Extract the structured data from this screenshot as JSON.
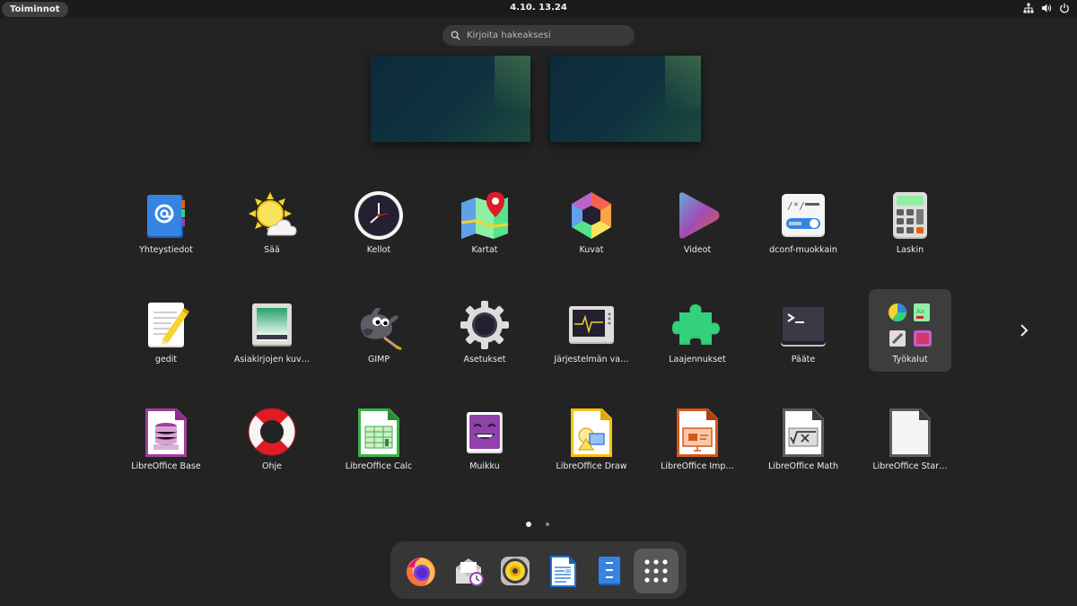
{
  "topbar": {
    "activities": "Toiminnot",
    "clock": "4.10.  13.24",
    "tray": {
      "network_icon": "network-wired-icon",
      "volume_icon": "speaker-icon",
      "power_icon": "power-icon"
    }
  },
  "search": {
    "placeholder": "Kirjoita hakeaksesi"
  },
  "apps": [
    {
      "label": "Yhteystiedot",
      "icon": "contacts-icon"
    },
    {
      "label": "Sää",
      "icon": "weather-icon"
    },
    {
      "label": "Kellot",
      "icon": "clock-icon"
    },
    {
      "label": "Kartat",
      "icon": "maps-icon"
    },
    {
      "label": "Kuvat",
      "icon": "photos-icon"
    },
    {
      "label": "Videot",
      "icon": "videos-icon"
    },
    {
      "label": "dconf-muokkain",
      "icon": "dconf-editor-icon"
    },
    {
      "label": "Laskin",
      "icon": "calculator-icon"
    },
    {
      "label": "gedit",
      "icon": "text-editor-icon"
    },
    {
      "label": "Asiakirjojen kuv…",
      "icon": "document-scanner-icon"
    },
    {
      "label": "GIMP",
      "icon": "gimp-icon"
    },
    {
      "label": "Asetukset",
      "icon": "settings-gear-icon"
    },
    {
      "label": "Järjestelmän va…",
      "icon": "system-monitor-icon"
    },
    {
      "label": "Laajennukset",
      "icon": "extensions-puzzle-icon"
    },
    {
      "label": "Pääte",
      "icon": "terminal-icon"
    },
    {
      "label": "Työkalut",
      "icon": "utilities-folder-icon"
    },
    {
      "label": "LibreOffice Base",
      "icon": "libreoffice-base-icon"
    },
    {
      "label": "Ohje",
      "icon": "help-lifebuoy-icon"
    },
    {
      "label": "LibreOffice Calc",
      "icon": "libreoffice-calc-icon"
    },
    {
      "label": "Muikku",
      "icon": "muikku-icon"
    },
    {
      "label": "LibreOffice Draw",
      "icon": "libreoffice-draw-icon"
    },
    {
      "label": "LibreOffice Imp…",
      "icon": "libreoffice-impress-icon"
    },
    {
      "label": "LibreOffice Math",
      "icon": "libreoffice-math-icon"
    },
    {
      "label": "LibreOffice Star…",
      "icon": "libreoffice-start-icon"
    }
  ],
  "pagination": {
    "current": 1,
    "total": 2
  },
  "dock": [
    {
      "icon": "firefox-icon"
    },
    {
      "icon": "evolution-mail-icon"
    },
    {
      "icon": "rhythmbox-icon"
    },
    {
      "icon": "libreoffice-writer-icon"
    },
    {
      "icon": "files-icon"
    },
    {
      "icon": "show-apps-grid-icon"
    }
  ]
}
